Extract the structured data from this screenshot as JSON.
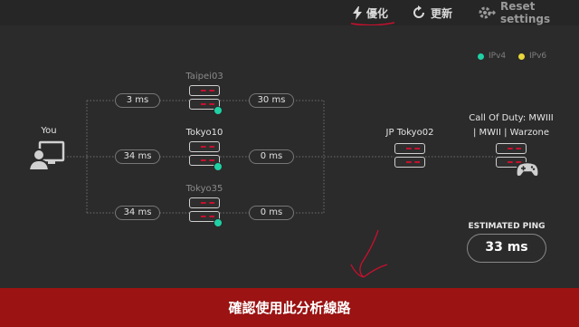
{
  "toolbar": {
    "optimize_label": "優化",
    "refresh_label": "更新",
    "reset_label": "Reset settings"
  },
  "legend": [
    {
      "label": "IPv4",
      "color": "#1fd1a4"
    },
    {
      "label": "IPv6",
      "color": "#e8d83a"
    }
  ],
  "route": {
    "source_label": "You",
    "relays": [
      {
        "name": "Taipei03",
        "ping_in": "3 ms",
        "ping_out": "30 ms",
        "selected": false
      },
      {
        "name": "Tokyo10",
        "ping_in": "34 ms",
        "ping_out": "0 ms",
        "selected": true
      },
      {
        "name": "Tokyo35",
        "ping_in": "34 ms",
        "ping_out": "0 ms",
        "selected": false
      }
    ],
    "endpoint_label": "JP Tokyo02",
    "game_label_line1": "Call Of Duty: MWIII",
    "game_label_line2": "| MWII | Warzone"
  },
  "estimated_ping": {
    "title": "ESTIMATED PING",
    "value": "33 ms"
  },
  "cta_label": "確認使用此分析線路"
}
